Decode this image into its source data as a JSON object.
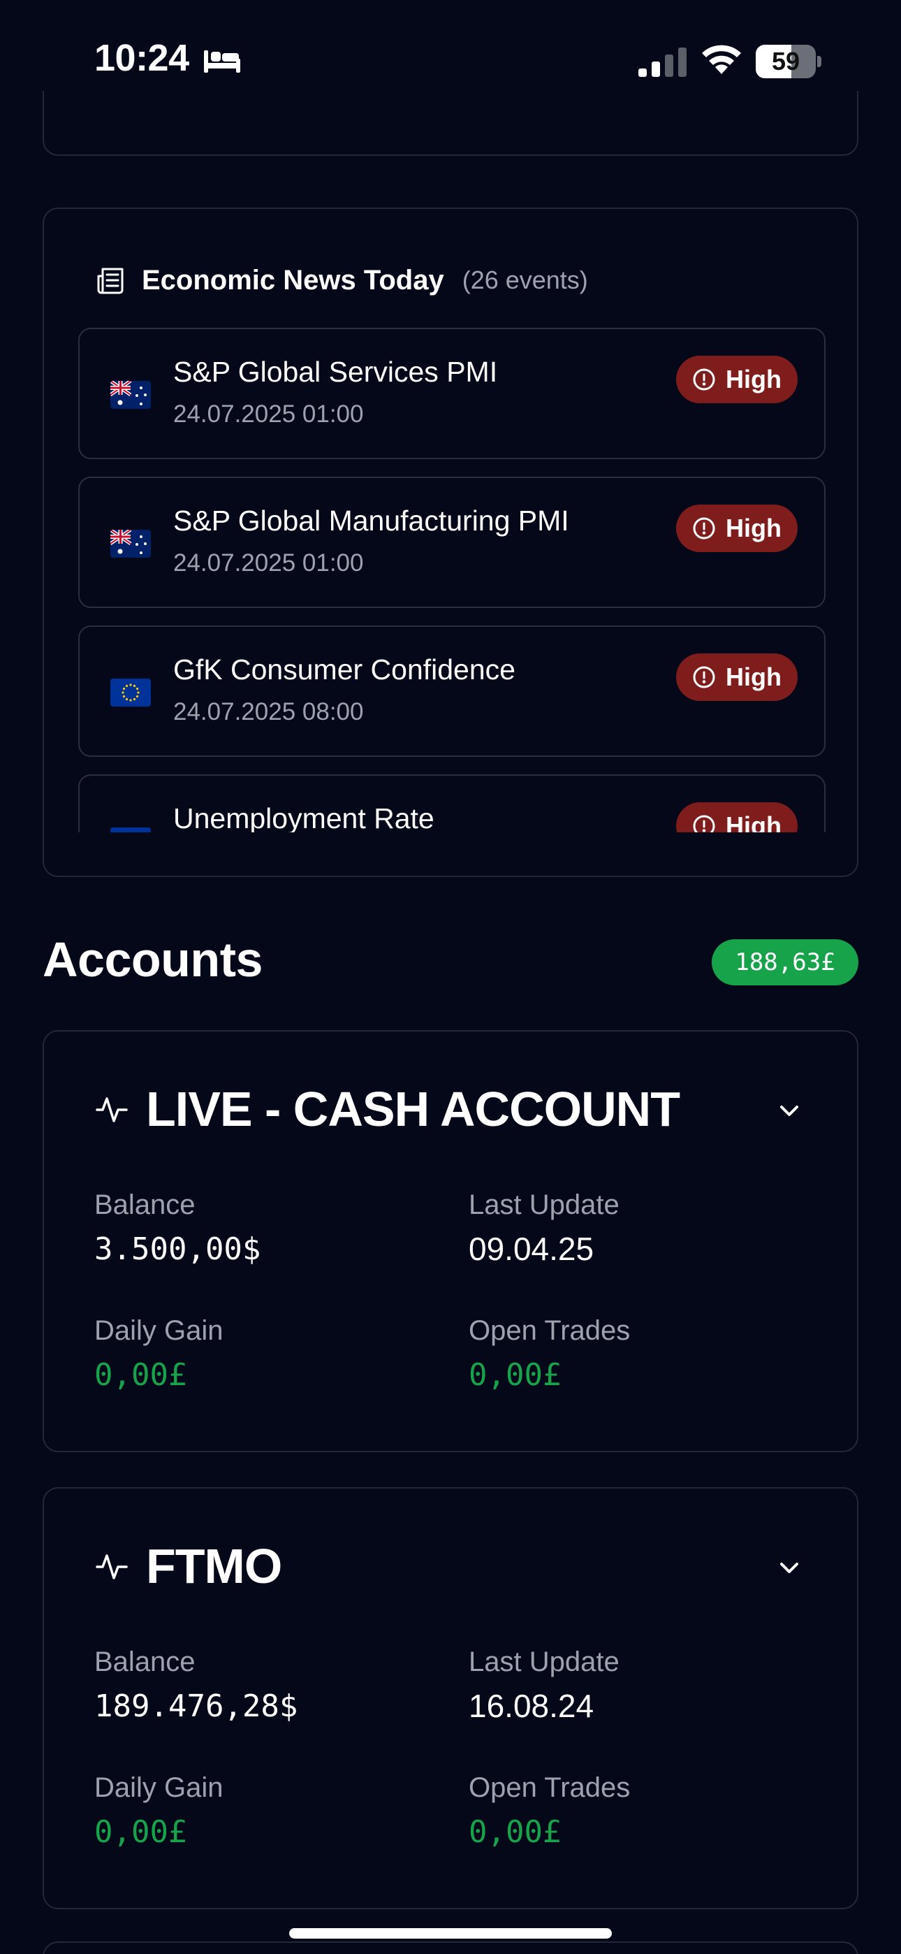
{
  "status_bar": {
    "time": "10:24",
    "sleep_icon": "bed-icon",
    "signal_icon": "cellular-signal-icon",
    "wifi_icon": "wifi-icon",
    "battery_level": 59,
    "battery_text": "59"
  },
  "news": {
    "icon": "newspaper-icon",
    "title": "Economic News Today",
    "count": "(26 events)",
    "items": [
      {
        "name": "S&P Global Services PMI",
        "date": "24.07.2025 01:00",
        "flag": "australia",
        "impact": "High"
      },
      {
        "name": "S&P Global Manufacturing PMI",
        "date": "24.07.2025 01:00",
        "flag": "australia",
        "impact": "High"
      },
      {
        "name": "GfK Consumer Confidence",
        "date": "24.07.2025 08:00",
        "flag": "european-union",
        "impact": "High"
      },
      {
        "name": "Unemployment Rate",
        "date": "",
        "flag": "european-union",
        "impact": "High"
      }
    ],
    "impact_color": "#7f1d1d"
  },
  "accounts": {
    "title": "Accounts",
    "total": "188,63£",
    "total_color": "#16a34a",
    "labels": {
      "balance": "Balance",
      "last_update": "Last Update",
      "daily_gain": "Daily Gain",
      "open_trades": "Open Trades"
    },
    "list": [
      {
        "name": "LIVE - CASH ACCOUNT",
        "balance": "3.500,00$",
        "last_update": "09.04.25",
        "daily_gain": "0,00£",
        "open_trades": "0,00£"
      },
      {
        "name": "FTMO",
        "balance": "189.476,28$",
        "last_update": "16.08.24",
        "daily_gain": "0,00£",
        "open_trades": "0,00£"
      }
    ]
  },
  "colors": {
    "background": "#050818",
    "card_border": "#232838",
    "muted_text": "#9ca3af",
    "positive": "#16a34a"
  }
}
